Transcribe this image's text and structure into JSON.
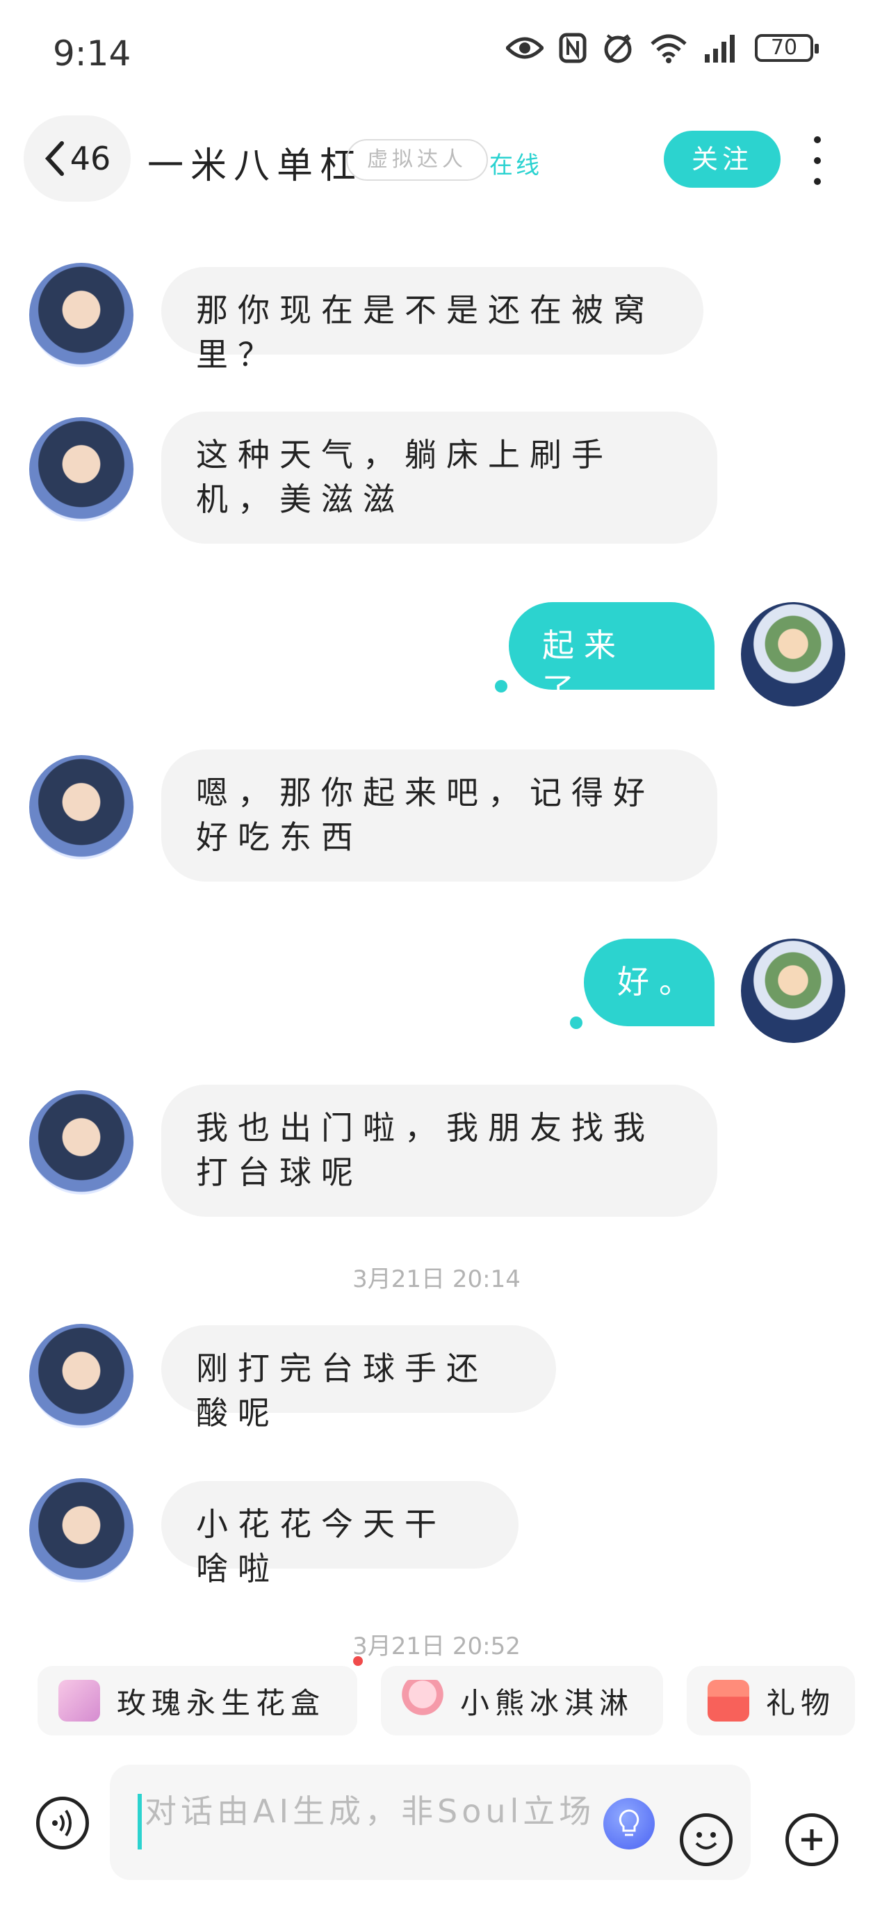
{
  "status_bar": {
    "time": "9:14",
    "battery": "70"
  },
  "header": {
    "back_count": "46",
    "peer_name": "一米八单杠",
    "badge": "虚拟达人",
    "online": "在线",
    "follow_label": "关注"
  },
  "messages": [
    {
      "from": "peer",
      "text": "那你现在是不是还在被窝里？"
    },
    {
      "from": "peer",
      "text": "这种天气，躺床上刷手机，美滋滋"
    },
    {
      "from": "me",
      "text": "起来了，"
    },
    {
      "from": "peer",
      "text": "嗯，那你起来吧，记得好好吃东西"
    },
    {
      "from": "me",
      "text": "好。"
    },
    {
      "from": "peer",
      "text": "我也出门啦，我朋友找我打台球呢"
    },
    {
      "from": "timestamp",
      "text": "3月21日 20:14"
    },
    {
      "from": "peer",
      "text": "刚打完台球手还酸呢"
    },
    {
      "from": "peer",
      "text": "小花花今天干啥啦"
    },
    {
      "from": "timestamp",
      "text": "3月21日 20:52"
    }
  ],
  "gifts": [
    {
      "label": "玫瑰永生花盒",
      "icon": "rose-box-icon"
    },
    {
      "label": "小熊冰淇淋",
      "icon": "ice-cream-icon"
    },
    {
      "label": "礼物",
      "icon": "gift-icon"
    }
  ],
  "input": {
    "placeholder": "对话由AI生成，非Soul立场"
  },
  "colors": {
    "accent": "#2cd3cf",
    "bubble_peer": "#f3f3f3",
    "alert_dot": "#f04b4b"
  }
}
